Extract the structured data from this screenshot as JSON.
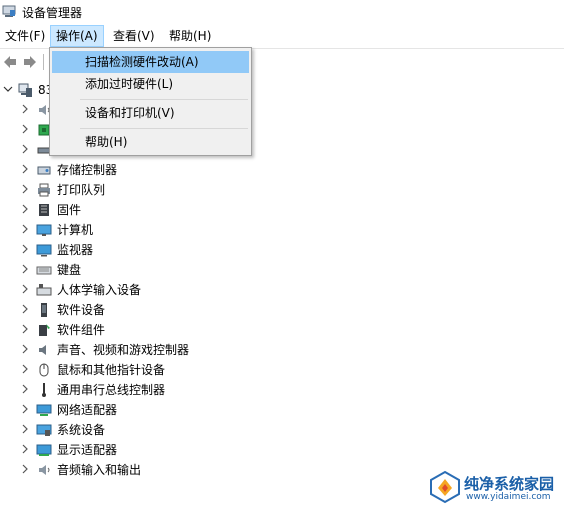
{
  "window": {
    "title": "设备管理器"
  },
  "menubar": {
    "items": [
      {
        "label": "文件(F)"
      },
      {
        "label": "操作(A)",
        "open": true
      },
      {
        "label": "查看(V)"
      },
      {
        "label": "帮助(H)"
      }
    ]
  },
  "toolbar": {
    "back_icon": "back-arrow-icon",
    "forward_icon": "forward-arrow-icon"
  },
  "action_menu": {
    "items": [
      {
        "label": "扫描检测硬件改动(A)",
        "highlighted": true
      },
      {
        "label": "添加过时硬件(L)"
      },
      {
        "label": "设备和打印机(V)"
      },
      {
        "label": "帮助(H)"
      }
    ]
  },
  "tree": {
    "root_label": "83",
    "items": [
      {
        "label": "",
        "icon": "audio-io-icon"
      },
      {
        "label": "",
        "icon": "processor-icon"
      },
      {
        "label": "",
        "icon": "disk-drive-icon"
      },
      {
        "label": "存储控制器",
        "icon": "storage-controller-icon"
      },
      {
        "label": "打印队列",
        "icon": "printer-icon"
      },
      {
        "label": "固件",
        "icon": "firmware-icon"
      },
      {
        "label": "计算机",
        "icon": "computer-icon"
      },
      {
        "label": "监视器",
        "icon": "monitor-icon"
      },
      {
        "label": "键盘",
        "icon": "keyboard-icon"
      },
      {
        "label": "人体学输入设备",
        "icon": "hid-icon"
      },
      {
        "label": "软件设备",
        "icon": "software-device-icon"
      },
      {
        "label": "软件组件",
        "icon": "software-component-icon"
      },
      {
        "label": "声音、视频和游戏控制器",
        "icon": "speaker-icon"
      },
      {
        "label": "鼠标和其他指针设备",
        "icon": "mouse-icon"
      },
      {
        "label": "通用串行总线控制器",
        "icon": "usb-icon"
      },
      {
        "label": "网络适配器",
        "icon": "network-adapter-icon"
      },
      {
        "label": "系统设备",
        "icon": "system-device-icon"
      },
      {
        "label": "显示适配器",
        "icon": "display-adapter-icon"
      },
      {
        "label": "音频输入和输出",
        "icon": "audio-io-icon"
      }
    ]
  },
  "watermark": {
    "name": "纯净系统家园",
    "url": "www.yidaimei.com"
  }
}
